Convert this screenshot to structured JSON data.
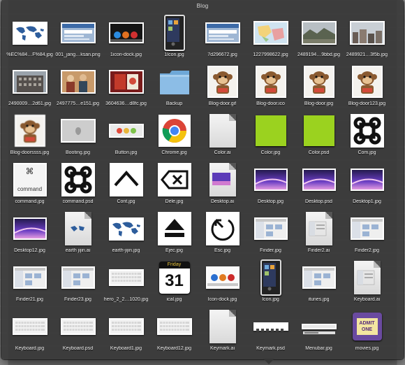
{
  "window": {
    "title": "Blog"
  },
  "colors": {
    "panel": "#363636",
    "green": "#9bd21f",
    "mac": "#6b3ec4"
  },
  "items": [
    {
      "label": "%EC%84…F%84.jpg",
      "kind": "worldmap"
    },
    {
      "label": "001_jang…ksan.png",
      "kind": "webpage"
    },
    {
      "label": "1icon-dock.jpg",
      "kind": "darkdock"
    },
    {
      "label": "1Icon.jpg",
      "kind": "iphone"
    },
    {
      "label": "7d296672.jpg",
      "kind": "webpage"
    },
    {
      "label": "1227998622.jpg",
      "kind": "mapcolor"
    },
    {
      "label": "2489194…9bbd.jpg",
      "kind": "landscape"
    },
    {
      "label": "2489921…3f5b.jpg",
      "kind": "town"
    },
    {
      "label": "2490009…2d61.jpg",
      "kind": "building"
    },
    {
      "label": "2497775…e151.jpg",
      "kind": "people"
    },
    {
      "label": "3604636…d8fc.jpg",
      "kind": "redbook"
    },
    {
      "label": "Backup",
      "kind": "folder"
    },
    {
      "label": "Blog-door.gif",
      "kind": "monkey"
    },
    {
      "label": "Blog-door.ico",
      "kind": "monkey"
    },
    {
      "label": "Blog-door.jpg",
      "kind": "monkey"
    },
    {
      "label": "Blog-door123.jpg",
      "kind": "monkey"
    },
    {
      "label": "Blog-doorssss.jpg",
      "kind": "monkeyblur"
    },
    {
      "label": "Booting.jpg",
      "kind": "booting"
    },
    {
      "label": "Button.jpg",
      "kind": "buttons"
    },
    {
      "label": "Chrome.jpg",
      "kind": "chrome"
    },
    {
      "label": "Color.ai",
      "kind": "docblank"
    },
    {
      "label": "Color.jpg",
      "kind": "green"
    },
    {
      "label": "Color.psd",
      "kind": "green"
    },
    {
      "label": "Com.jpg",
      "kind": "cmd"
    },
    {
      "label": "command.jpg",
      "kind": "cmdkey"
    },
    {
      "label": "command.psd",
      "kind": "cmd"
    },
    {
      "label": "Cont.jpg",
      "kind": "caret"
    },
    {
      "label": "Dele.jpg",
      "kind": "delete"
    },
    {
      "label": "Desktop.ai",
      "kind": "docmac"
    },
    {
      "label": "Desktop.jpg",
      "kind": "mac"
    },
    {
      "label": "Desktop.psd",
      "kind": "mac"
    },
    {
      "label": "Desktop1.jpg",
      "kind": "mac"
    },
    {
      "label": "Desktop12.jpg",
      "kind": "mac"
    },
    {
      "label": "earth jijin.ai",
      "kind": "docmap"
    },
    {
      "label": "earth-jijin.jpg",
      "kind": "worldmap"
    },
    {
      "label": "Ejec.jpg",
      "kind": "eject"
    },
    {
      "label": "Esc.jpg",
      "kind": "esc"
    },
    {
      "label": "Finder.jpg",
      "kind": "finder"
    },
    {
      "label": "Finder2.ai",
      "kind": "docfinder"
    },
    {
      "label": "Finder2.jpg",
      "kind": "finder"
    },
    {
      "label": "Finder21.jpg",
      "kind": "finder"
    },
    {
      "label": "Finder23.jpg",
      "kind": "finder"
    },
    {
      "label": "hero_2_2…1020.jpg",
      "kind": "keyboard"
    },
    {
      "label": "ical.jpg",
      "kind": "ical"
    },
    {
      "label": "Icon-dock.jpg",
      "kind": "icondock"
    },
    {
      "label": "Icon.jpg",
      "kind": "iphone"
    },
    {
      "label": "itunes.jpg",
      "kind": "finder"
    },
    {
      "label": "Keyboard.ai",
      "kind": "docfinder"
    },
    {
      "label": "Keyboard.jpg",
      "kind": "keyboard"
    },
    {
      "label": "Keyboard.psd",
      "kind": "keyboard"
    },
    {
      "label": "Keyboard1.jpg",
      "kind": "keyboard"
    },
    {
      "label": "Keyboard12.jpg",
      "kind": "keyboard"
    },
    {
      "label": "Keymark.ai",
      "kind": "docblank"
    },
    {
      "label": "Keymark.psd",
      "kind": "keymark"
    },
    {
      "label": "Menubar.jpg",
      "kind": "menubar"
    },
    {
      "label": "movies.jpg",
      "kind": "ticket"
    }
  ],
  "ical": {
    "day": "Friday",
    "date": "31"
  },
  "ticket": {
    "text": "ADMIT ONE"
  },
  "cmdkey": {
    "text": "command"
  }
}
